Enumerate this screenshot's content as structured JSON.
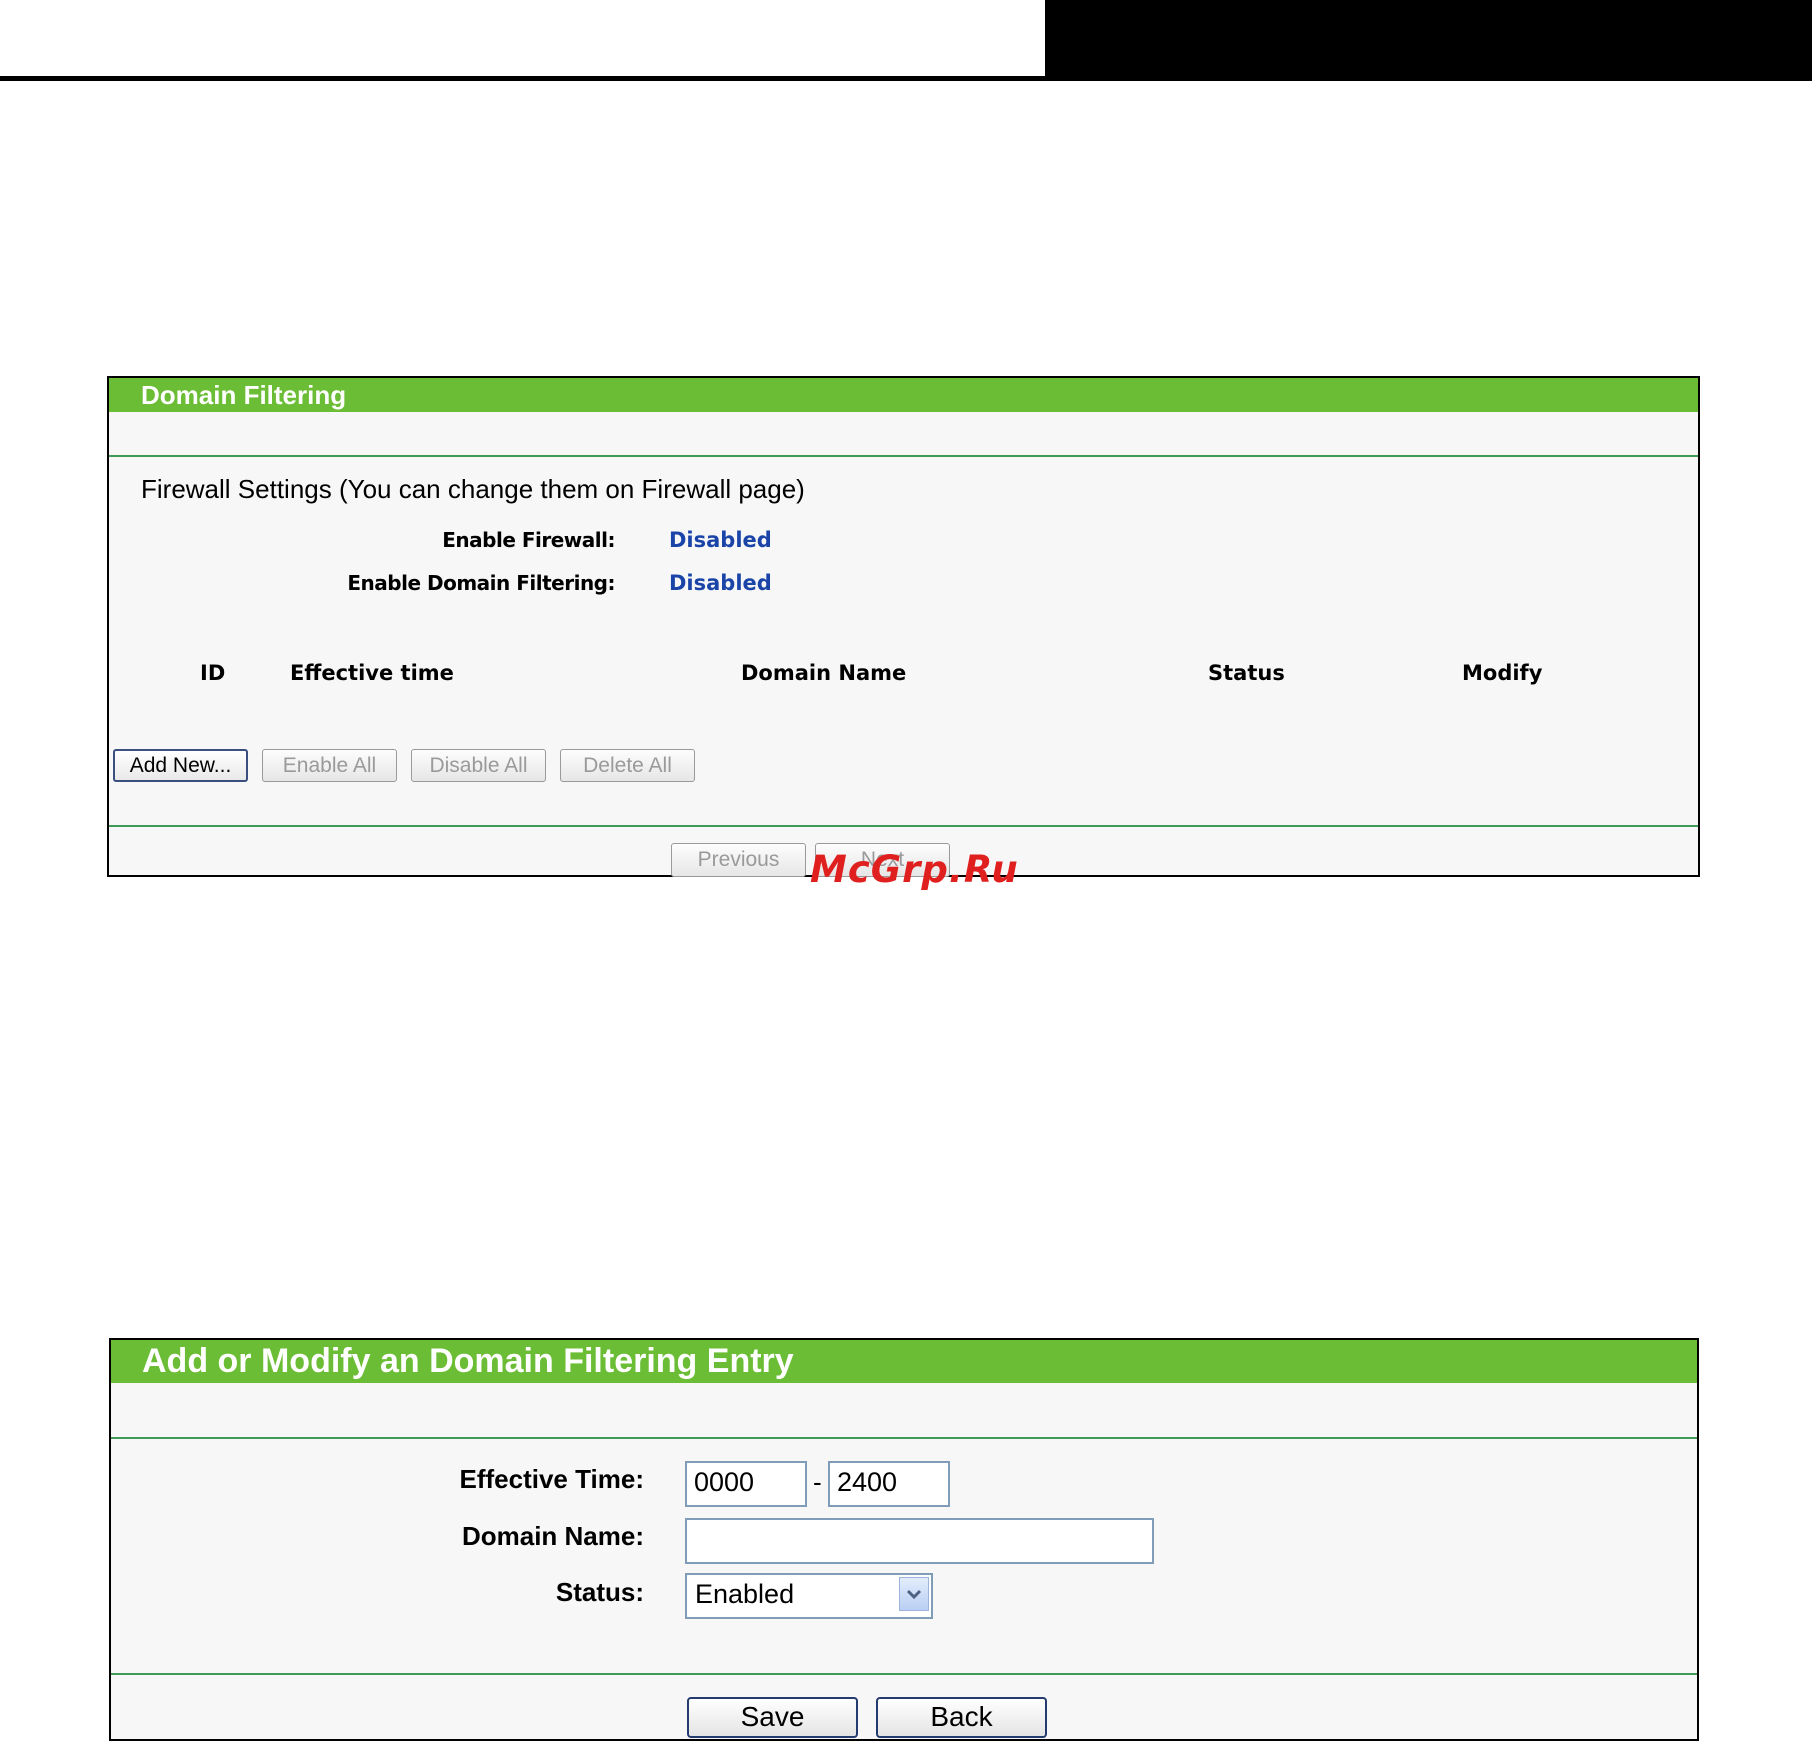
{
  "panel1": {
    "title": "Domain Filtering",
    "firewall_heading": "Firewall Settings (You can change them on Firewall page)",
    "enable_firewall_label": "Enable Firewall:",
    "enable_firewall_value": "Disabled",
    "enable_domain_label": "Enable Domain Filtering:",
    "enable_domain_value": "Disabled",
    "columns": [
      "ID",
      "Effective time",
      "Domain Name",
      "Status",
      "Modify"
    ],
    "buttons": {
      "add_new": "Add New...",
      "enable_all": "Enable All",
      "disable_all": "Disable All",
      "delete_all": "Delete All",
      "previous": "Previous",
      "next": "Next"
    }
  },
  "watermark": "McGrp.Ru",
  "panel2": {
    "title": "Add or Modify an Domain Filtering Entry",
    "effective_time_label": "Effective Time:",
    "time_start": "0000",
    "time_separator": "-",
    "time_end": "2400",
    "domain_name_label": "Domain Name:",
    "domain_name_value": "",
    "status_label": "Status:",
    "status_value": "Enabled",
    "save_label": "Save",
    "back_label": "Back"
  }
}
